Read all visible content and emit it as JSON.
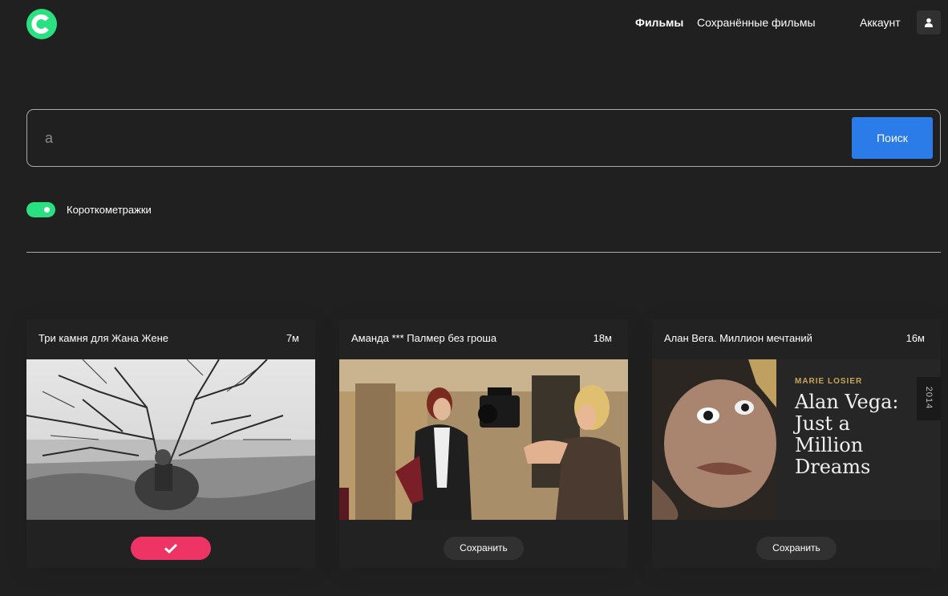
{
  "header": {
    "logo": "logo-c-icon",
    "nav": {
      "movies": "Фильмы",
      "saved": "Сохранённые фильмы",
      "account": "Аккаунт"
    },
    "account_icon": "user-icon"
  },
  "search": {
    "value": "а",
    "button": "Поиск"
  },
  "filter": {
    "shorts_label": "Короткометражки",
    "shorts_on": true
  },
  "colors": {
    "accent_green": "#2be080",
    "button_blue": "#2b7ce8",
    "saved_pink": "#ee3465",
    "background": "#202020"
  },
  "movies": [
    {
      "title": "Три камня для Жана Жене",
      "duration": "7м",
      "saved": true,
      "button_icon": "check-icon"
    },
    {
      "title": "Аманда *** Палмер без гроша",
      "duration": "18м",
      "saved": false,
      "button_label": "Сохранить"
    },
    {
      "title": "Алан Вега. Миллион мечтаний",
      "duration": "16м",
      "saved": false,
      "button_label": "Сохранить",
      "poster": {
        "author": "MARIE LOSIER",
        "title": "Alan Vega: Just a Million Dreams",
        "year": "2014"
      }
    }
  ]
}
